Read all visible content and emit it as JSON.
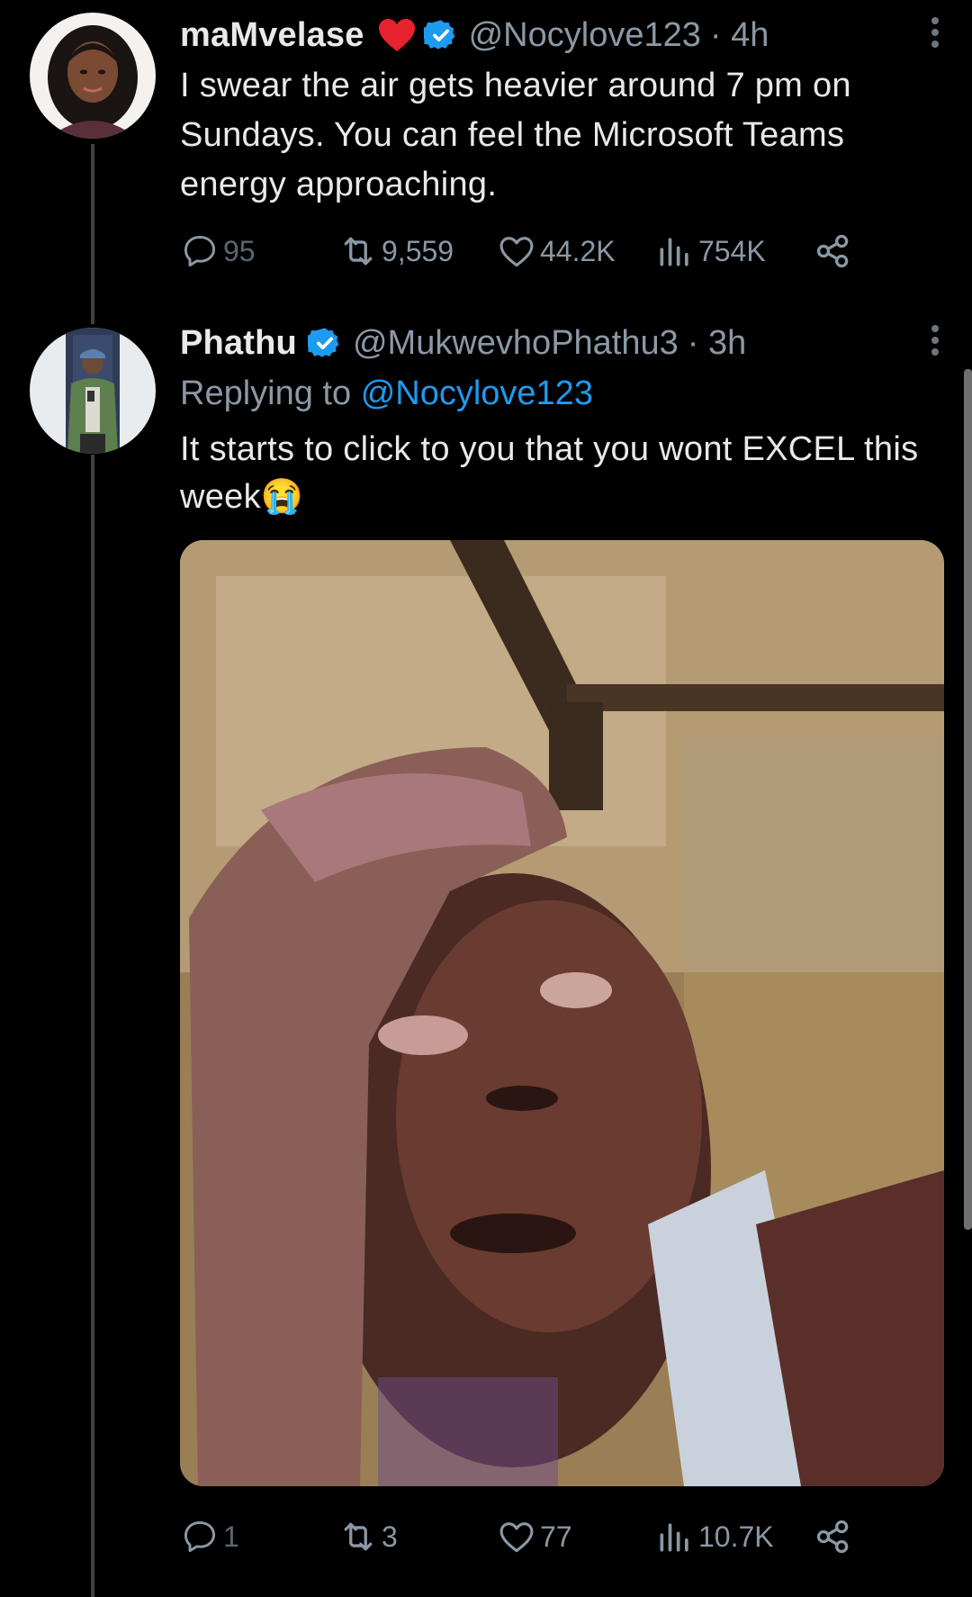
{
  "tweets": [
    {
      "display_name": "maMvelase",
      "handle": "@Nocylove123",
      "time": "· 4h",
      "text": "I swear the air gets heavier around 7 pm on Sundays. You can feel the Microsoft Teams energy approaching.",
      "stats": {
        "replies": "95",
        "retweets": "9,559",
        "likes": "44.2K",
        "views": "754K"
      }
    },
    {
      "display_name": "Phathu",
      "handle": "@MukwevhoPhathu3",
      "time": "· 3h",
      "replying_prefix": "Replying to",
      "replying_to": "@Nocylove123",
      "text": "It starts to click to you that you wont EXCEL this week😭",
      "stats": {
        "replies": "1",
        "retweets": "3",
        "likes": "77",
        "views": "10.7K"
      }
    }
  ],
  "icons": {
    "verified": "verified-badge-icon",
    "heart_emoji": "red-heart-emoji-icon",
    "more": "more-vertical-icon",
    "reply": "reply-bubble-icon",
    "retweet": "retweet-icon",
    "like": "heart-outline-icon",
    "views": "views-bars-icon",
    "share": "share-icon"
  },
  "colors": {
    "background": "#000000",
    "primary_text": "#e7e9ea",
    "secondary_text": "#8b98a5",
    "accent": "#1d9bf0",
    "heart": "#e8212f"
  }
}
